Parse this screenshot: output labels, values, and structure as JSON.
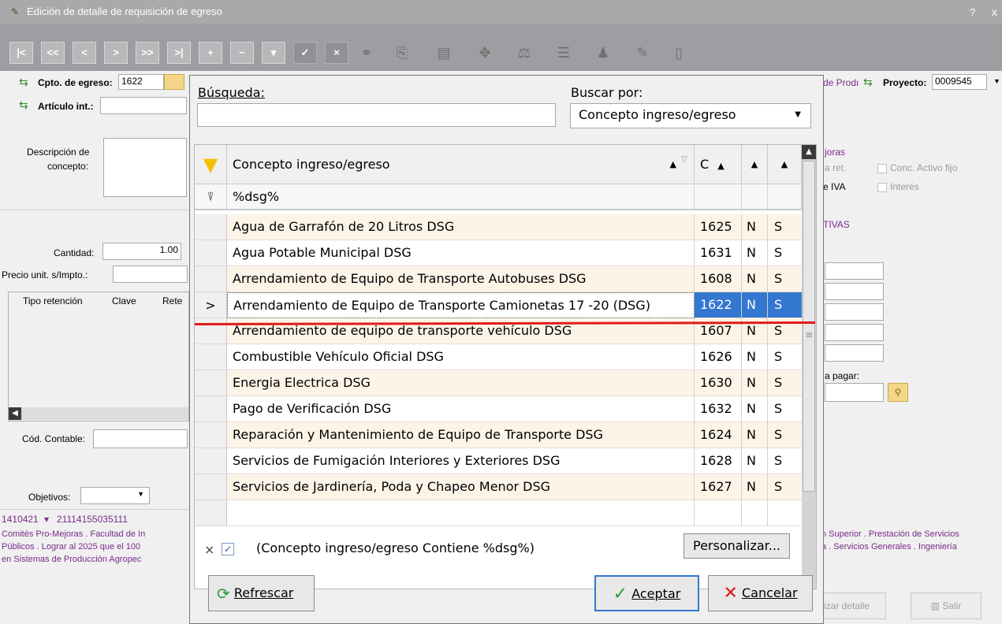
{
  "window": {
    "title": "Edición de detalle de requisición de egreso",
    "help": "?",
    "close": "x"
  },
  "toolbar": {
    "first": "|<",
    "prev_page": "<<",
    "prev": "<",
    "next": ">",
    "next_page": ">>",
    "last": ">|",
    "add": "+",
    "remove": "−",
    "edit": "▾",
    "confirm": "✓",
    "cancel": "×"
  },
  "form": {
    "concepto_label": "Cpto. de egreso:",
    "concepto_value": "1622",
    "articulo_label": "Artículo int.:",
    "descripcion_label": "Descripción de concepto:",
    "descripcion_label_1": "Descripción de",
    "descripcion_label_2": "concepto:",
    "cantidad_label": "Cantidad:",
    "cantidad_value": "1.00",
    "precio_label": "Precio unit. s/Impto.:",
    "ret_headers": [
      "Tipo retención",
      "Clave",
      "Rete"
    ],
    "cod_contable_label": "Cód. Contable:",
    "objetivos_label": "Objetivos:",
    "cuenta_a": "1410421",
    "cuenta_b": "21114155035111",
    "desc_left_1": "Comités Pro-Mejoras . Facultad de In",
    "desc_left_2": "Públicos . Lograr al 2025 que el 100",
    "desc_left_3": "en Sistemas de Producción Agropec",
    "right_prod_label": "de Prodı",
    "proyecto_label": "Proyecto:",
    "proyecto_value": "0009545",
    "joras": "joras",
    "a_ret": "a ret.",
    "e_iva": "e IVA",
    "conc_activo": "Conc. Activo fijo",
    "interes": "Interés",
    "tivas": "TIVAS",
    "a_pagar": "a pagar:",
    "desc_right_1": "n Superior . Prestación de Servicios",
    "desc_right_2": "a . Servicios Generales . Ingeniería",
    "realizar_detalle": "izar detalle",
    "salir": "Salir"
  },
  "popup": {
    "busqueda_label": "Búsqueda:",
    "buscar_por_label": "Buscar por:",
    "buscar_por_value": "Concepto ingreso/egreso",
    "col_concepto": "Concepto ingreso/egreso",
    "col_c": "C",
    "filter_text": "%dsg%",
    "rows": [
      {
        "concepto": "Agua de Garrafón de 20 Litros DSG",
        "clave": "1625",
        "a": "N",
        "b": "S"
      },
      {
        "concepto": "Agua Potable Municipal DSG",
        "clave": "1631",
        "a": "N",
        "b": "S"
      },
      {
        "concepto": "Arrendamiento de Equipo de Transporte Autobuses DSG",
        "clave": "1608",
        "a": "N",
        "b": "S"
      },
      {
        "concepto": "Arrendamiento de Equipo de Transporte Camionetas 17 -20 (DSG)",
        "clave": "1622",
        "a": "N",
        "b": "S"
      },
      {
        "concepto": "Arrendamiento de equipo de transporte vehículo DSG",
        "clave": "1607",
        "a": "N",
        "b": "S"
      },
      {
        "concepto": "Combustible Vehículo Oficial DSG",
        "clave": "1626",
        "a": "N",
        "b": "S"
      },
      {
        "concepto": "Energia Electrica DSG",
        "clave": "1630",
        "a": "N",
        "b": "S"
      },
      {
        "concepto": "Pago de Verificación DSG",
        "clave": "1632",
        "a": "N",
        "b": "S"
      },
      {
        "concepto": "Reparación y Mantenimiento de Equipo de Transporte DSG",
        "clave": "1624",
        "a": "N",
        "b": "S"
      },
      {
        "concepto": "Servicios de Fumigación Interiores y Exteriores DSG",
        "clave": "1628",
        "a": "N",
        "b": "S"
      },
      {
        "concepto": "Servicios de Jardinería, Poda y Chapeo Menor DSG",
        "clave": "1627",
        "a": "N",
        "b": "S"
      }
    ],
    "filter_summary": "(Concepto ingreso/egreso Contiene %dsg%)",
    "personalizar": "Personalizar...",
    "refrescar": "Refrescar",
    "aceptar": "Aceptar",
    "cancelar": "Cancelar",
    "selected_marker": ">"
  },
  "colors": {
    "selection": "#3377d0",
    "annotation_line": "#e01b1b",
    "row_tint": "#fdf4e8"
  }
}
